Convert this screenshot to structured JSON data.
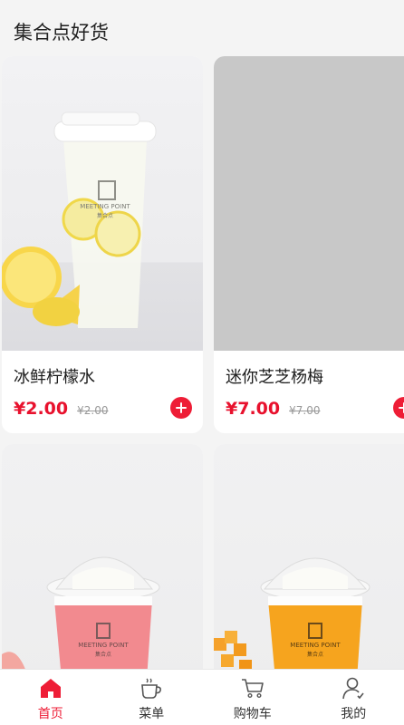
{
  "header": {
    "title": "集合点好货"
  },
  "products": [
    {
      "name": "冰鲜柠檬水",
      "price": "¥2.00",
      "original_price": "¥2.00",
      "image": "lemonade-cup-image"
    },
    {
      "name": "迷你芝芝杨梅",
      "price": "¥7.00",
      "original_price": "¥7.00",
      "image": "placeholder-image"
    },
    {
      "name": "",
      "price": "",
      "original_price": "",
      "image": "strawberry-cup-image"
    },
    {
      "name": "",
      "price": "",
      "original_price": "",
      "image": "mango-cup-image"
    }
  ],
  "cup_brand": {
    "line1": "MEETING POINT",
    "line2": "集合点"
  },
  "tabbar": {
    "tabs": [
      {
        "label": "首页",
        "icon": "home-icon",
        "active": true
      },
      {
        "label": "菜单",
        "icon": "coffee-cup-icon",
        "active": false
      },
      {
        "label": "购物车",
        "icon": "cart-icon",
        "active": false
      },
      {
        "label": "我的",
        "icon": "user-icon",
        "active": false
      }
    ]
  },
  "colors": {
    "accent": "#ee1d36",
    "price": "#e8112d",
    "background": "#f4f4f4"
  }
}
